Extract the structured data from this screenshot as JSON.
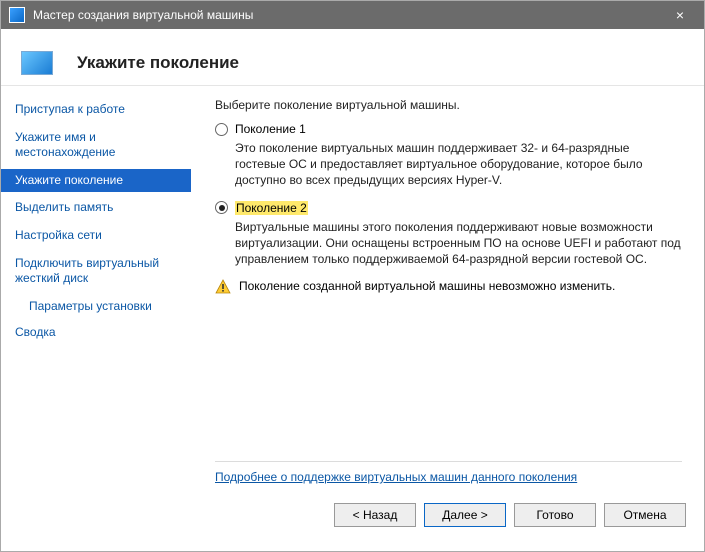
{
  "window": {
    "title": "Мастер создания виртуальной машины"
  },
  "header": {
    "title": "Укажите поколение"
  },
  "sidebar": {
    "items": [
      {
        "label": "Приступая к работе"
      },
      {
        "label": "Укажите имя и местонахождение"
      },
      {
        "label": "Укажите поколение"
      },
      {
        "label": "Выделить память"
      },
      {
        "label": "Настройка сети"
      },
      {
        "label": "Подключить виртуальный жесткий диск"
      },
      {
        "label": "Параметры установки"
      },
      {
        "label": "Сводка"
      }
    ],
    "active_index": 2,
    "sub_index": 6
  },
  "main": {
    "intro": "Выберите поколение виртуальной машины.",
    "options": [
      {
        "label": "Поколение 1",
        "desc": "Это поколение виртуальных машин поддерживает 32- и 64-разрядные гостевые ОС и предоставляет виртуальное оборудование, которое было доступно во всех предыдущих версиях Hyper-V."
      },
      {
        "label": "Поколение 2",
        "desc": "Виртуальные машины этого поколения поддерживают новые возможности виртуализации. Они оснащены встроенным ПО на основе UEFI и работают под управлением только поддерживаемой 64-разрядной версии гостевой ОС."
      }
    ],
    "selected_index": 1,
    "warning": "Поколение созданной виртуальной машины невозможно изменить.",
    "link": "Подробнее о поддержке виртуальных машин данного поколения"
  },
  "footer": {
    "back": "< Назад",
    "next": "Далее >",
    "finish": "Готово",
    "cancel": "Отмена"
  }
}
